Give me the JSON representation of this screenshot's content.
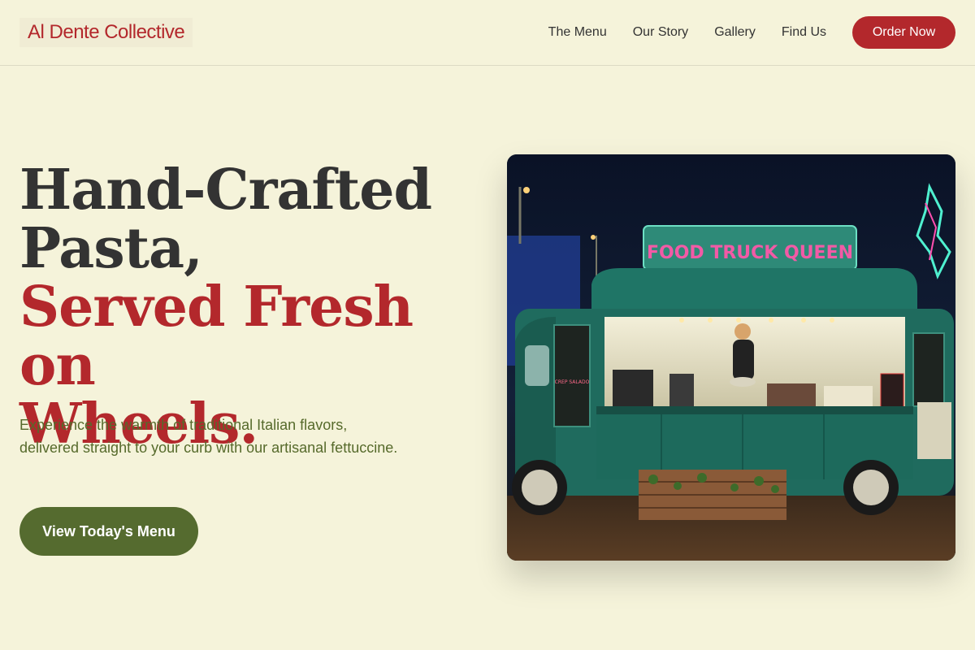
{
  "header": {
    "logo": "Al Dente Collective",
    "nav": [
      "The Menu",
      "Our Story",
      "Gallery",
      "Find Us"
    ],
    "order_label": "Order Now"
  },
  "hero": {
    "title_line1": "Hand-Crafted",
    "title_line2": "Pasta,",
    "title_line3": "Served Fresh on",
    "title_line4": "Wheels.",
    "subtitle": "Experience the warmth of traditional Italian flavors, delivered straight to your curb with our artisanal fettuccine.",
    "cta_label": "View Today's Menu"
  },
  "image": {
    "sign_text": "FOOD TRUCK QUEEN",
    "menu_board_text": "CREP SALADO"
  },
  "colors": {
    "background": "#f5f3da",
    "brand_red": "#b3282c",
    "olive": "#556b2f",
    "text_dark": "#333333",
    "truck_teal": "#1f6b5e"
  }
}
